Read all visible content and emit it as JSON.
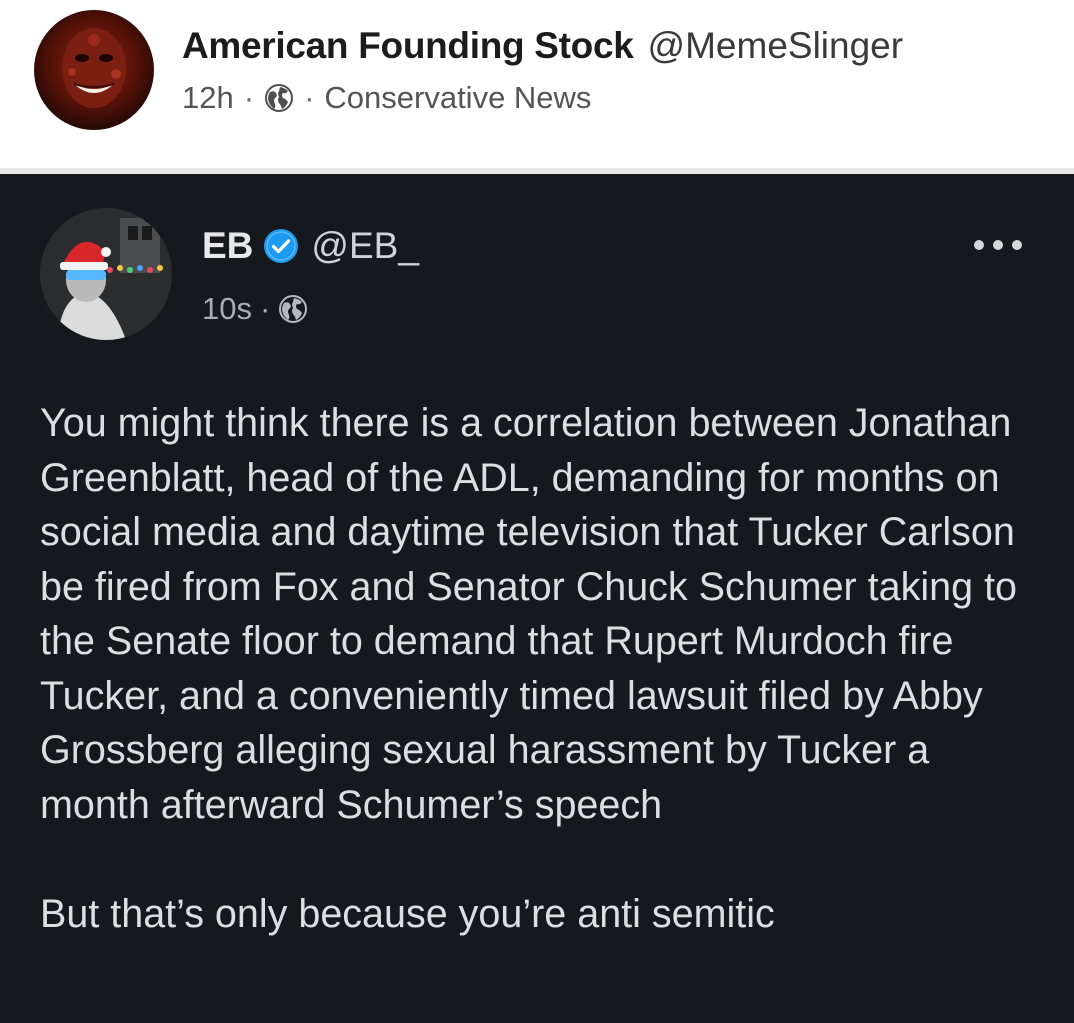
{
  "post": {
    "author_name": "American Founding Stock",
    "author_handle": "@MemeSlinger",
    "time": "12h",
    "separator": "·",
    "group": "Conservative News"
  },
  "tweet": {
    "author_name": "EB",
    "author_handle": "@EB_",
    "time": "10s",
    "separator": "·",
    "verified": true,
    "paragraphs": [
      "You might think there is a correlation between Jonathan Greenblatt, head of the ADL, demanding for months on social media and daytime television that Tucker Carlson be fired from Fox and Senator Chuck Schumer taking to the Senate floor to demand that Rupert Murdoch fire Tucker, and a conveniently timed lawsuit filed by Abby Grossberg alleging sexual harassment by Tucker a month afterward Schumer’s speech",
      "But that’s only because you’re anti semitic"
    ]
  },
  "icons": {
    "globe": "globe-icon",
    "verified": "verified-badge-icon",
    "more": "more-options-icon"
  },
  "colors": {
    "post_background": "#ffffff",
    "tweet_background": "#15181d",
    "verified_blue": "#1d9bf0",
    "tweet_text": "#dcdee0"
  }
}
